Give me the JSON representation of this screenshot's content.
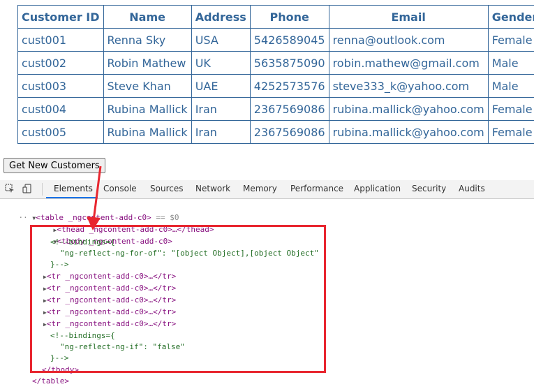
{
  "table": {
    "headers": [
      "Customer ID",
      "Name",
      "Address",
      "Phone",
      "Email",
      "Gender"
    ],
    "rows": [
      [
        "cust001",
        "Renna Sky",
        "USA",
        "5426589045",
        "renna@outlook.com",
        "Female"
      ],
      [
        "cust002",
        "Robin Mathew",
        "UK",
        "5635875090",
        "robin.mathew@gmail.com",
        "Male"
      ],
      [
        "cust003",
        "Steve Khan",
        "UAE",
        "4252573576",
        "steve333_k@yahoo.com",
        "Male"
      ],
      [
        "cust004",
        "Rubina Mallick",
        "Iran",
        "2367569086",
        "rubina.mallick@yahoo.com",
        "Female"
      ],
      [
        "cust005",
        "Rubina Mallick",
        "Iran",
        "2367569086",
        "rubina.mallick@yahoo.com",
        "Female"
      ]
    ]
  },
  "button": {
    "label": "Get New Customers"
  },
  "devtools": {
    "tabs": [
      "Elements",
      "Console",
      "Sources",
      "Network",
      "Memory",
      "Performance",
      "Application",
      "Security",
      "Audits"
    ],
    "active_tab": "Elements",
    "icons": [
      "inspect-element-icon",
      "device-toolbar-icon"
    ],
    "lines": {
      "table_open": "<table _ngcontent-add-c0>",
      "table_marker": "== $0",
      "thead": "<thead _ngcontent-add-c0>…</thead>",
      "tbody_open": "<tbody _ngcontent-add-c0>",
      "comment1_open": "<!--bindings={",
      "comment1_body": "\"ng-reflect-ng-for-of\": \"[object Object],[object Object\"",
      "comment_close": "}-->",
      "tr": "<tr _ngcontent-add-c0>…</tr>",
      "comment2_open": "<!--bindings={",
      "comment2_body": "\"ng-reflect-ng-if\": \"false\"",
      "tbody_close": "</tbody>",
      "table_close": "</table>"
    }
  },
  "colors": {
    "table_text": "#336699",
    "highlight": "#e8262f",
    "active_tab": "#1a73e8"
  }
}
